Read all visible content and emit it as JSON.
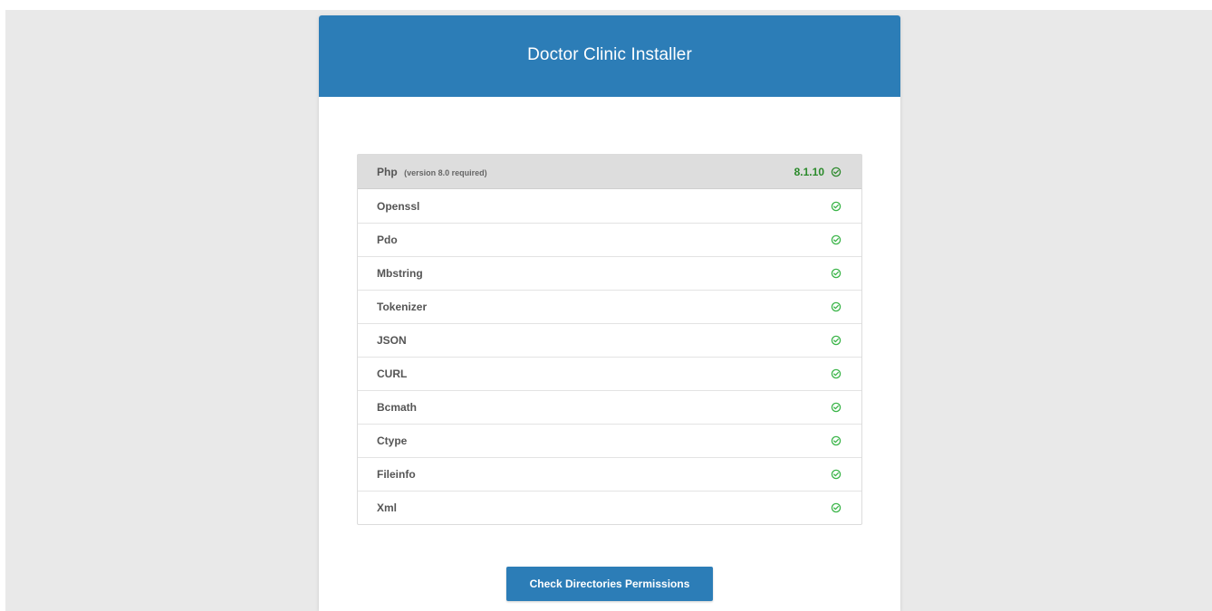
{
  "installer": {
    "title": "Doctor Clinic Installer",
    "button_label": "Check Directories Permissions",
    "requirements": [
      {
        "name": "Php",
        "note": "(version 8.0 required)",
        "version": "8.1.10",
        "status": "ok"
      },
      {
        "name": "Openssl",
        "status": "ok"
      },
      {
        "name": "Pdo",
        "status": "ok"
      },
      {
        "name": "Mbstring",
        "status": "ok"
      },
      {
        "name": "Tokenizer",
        "status": "ok"
      },
      {
        "name": "JSON",
        "status": "ok"
      },
      {
        "name": "CURL",
        "status": "ok"
      },
      {
        "name": "Bcmath",
        "status": "ok"
      },
      {
        "name": "Ctype",
        "status": "ok"
      },
      {
        "name": "Fileinfo",
        "status": "ok"
      },
      {
        "name": "Xml",
        "status": "ok"
      }
    ]
  },
  "icons": {
    "check": "check-circle-icon"
  },
  "colors": {
    "accent": "#2c7db7",
    "ok_icon": "#3cb54a",
    "version_text": "#2a8a2a",
    "page_background": "#e9e9e9"
  }
}
